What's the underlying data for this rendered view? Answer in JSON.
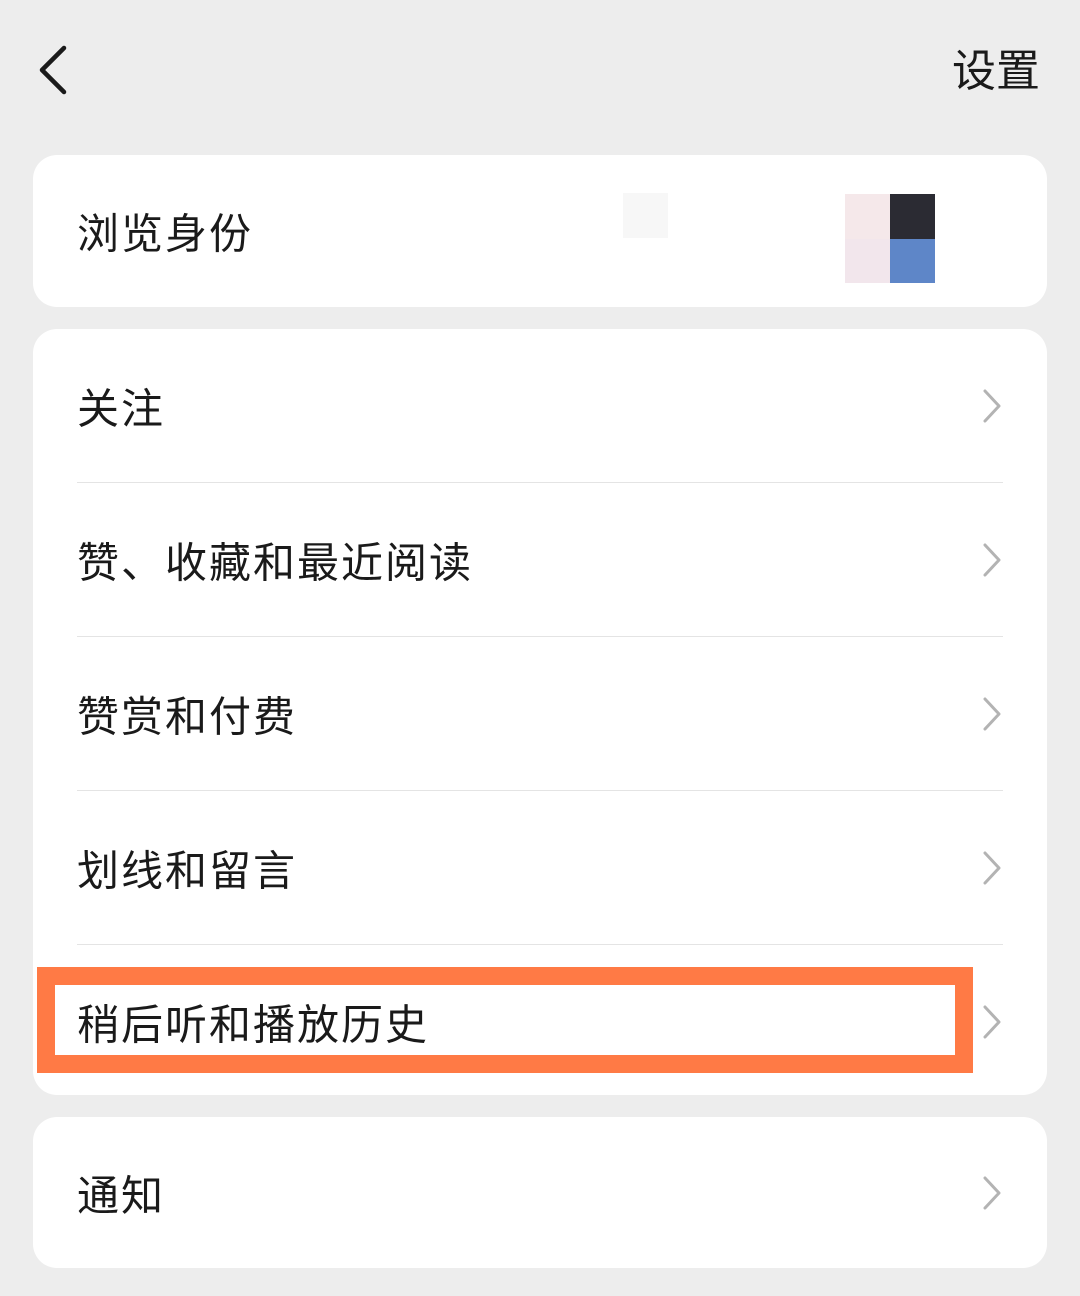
{
  "header": {
    "back_icon": "chevron-left-icon",
    "settings_label": "设置"
  },
  "identity": {
    "label": "浏览身份",
    "avatar_colors": [
      "#f5e8ea",
      "#2b2b33",
      "#f2e6ec",
      "#5e86c8"
    ]
  },
  "menu": {
    "items": [
      {
        "label": "关注",
        "icon": "chevron-right-icon"
      },
      {
        "label": "赞、收藏和最近阅读",
        "icon": "chevron-right-icon"
      },
      {
        "label": "赞赏和付费",
        "icon": "chevron-right-icon"
      },
      {
        "label": "划线和留言",
        "icon": "chevron-right-icon"
      },
      {
        "label": "稍后听和播放历史",
        "icon": "chevron-right-icon",
        "highlighted": true
      }
    ]
  },
  "notify": {
    "label": "通知",
    "icon": "chevron-right-icon"
  },
  "colors": {
    "background": "#ededed",
    "card": "#ffffff",
    "highlight": "#ff7a45",
    "chevron": "#b3b3b3"
  }
}
